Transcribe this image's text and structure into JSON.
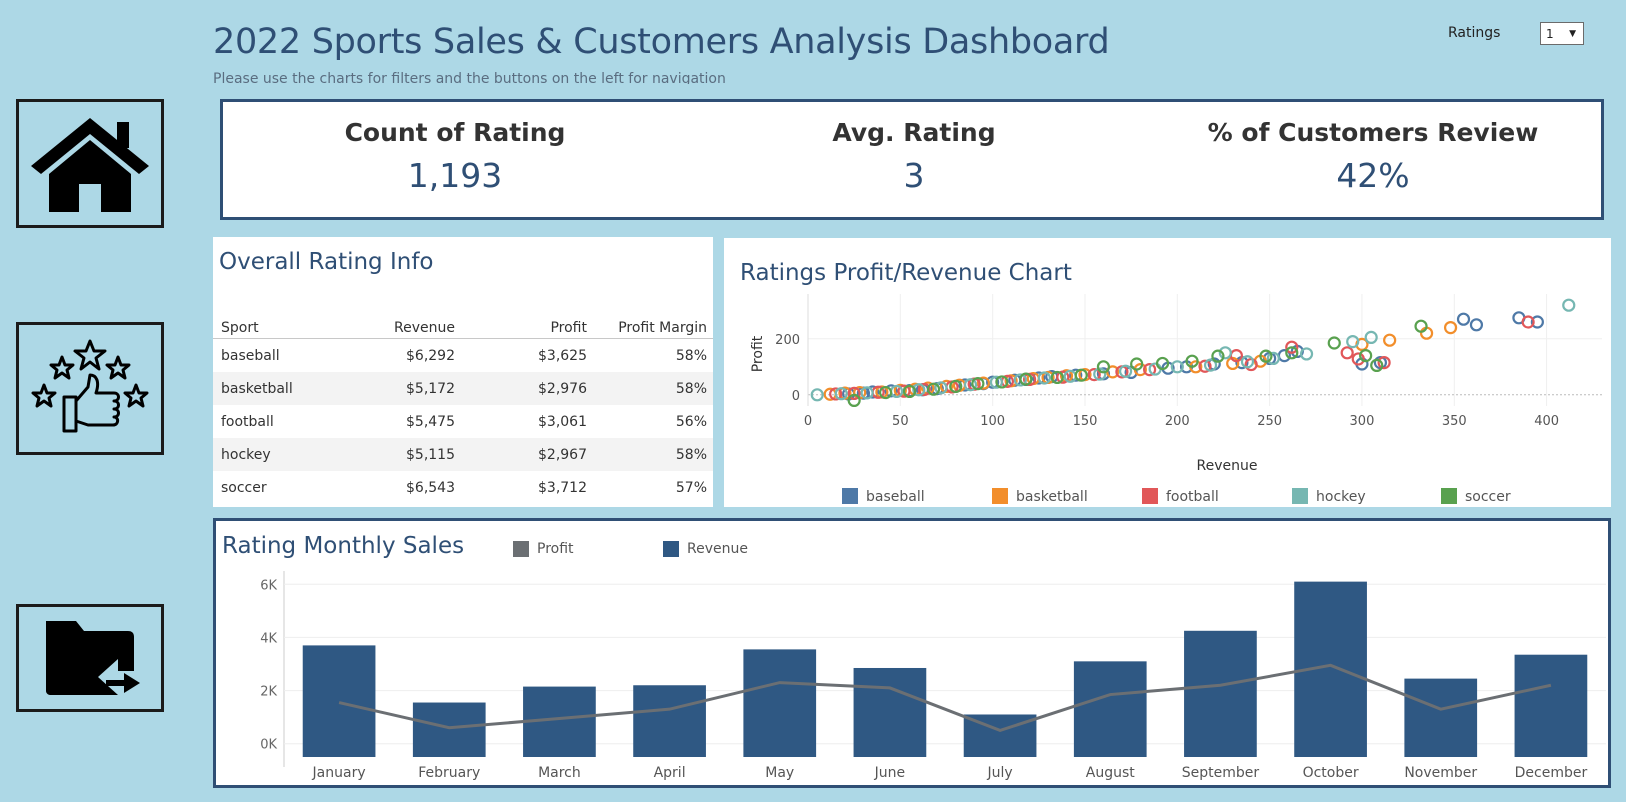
{
  "header": {
    "title": "2022 Sports Sales & Customers Analysis Dashboard",
    "subtitle": "Please use the charts for filters and the buttons on the left for navigation",
    "ratings_label": "Ratings",
    "ratings_value": "1"
  },
  "nav": [
    {
      "icon": "home-icon"
    },
    {
      "icon": "star-thumbs-up-icon"
    },
    {
      "icon": "folder-export-icon"
    }
  ],
  "kpis": {
    "count": {
      "title": "Count of Rating",
      "value": "1,193"
    },
    "avg": {
      "title": "Avg. Rating",
      "value": "3"
    },
    "pct": {
      "title": "% of Customers Review",
      "value": "42%"
    }
  },
  "rating_table": {
    "title": "Overall Rating Info",
    "headers": [
      "Sport",
      "Revenue",
      "Profit",
      "Profit Margin"
    ],
    "rows": [
      [
        "baseball",
        "$6,292",
        "$3,625",
        "58%"
      ],
      [
        "basketball",
        "$5,172",
        "$2,976",
        "58%"
      ],
      [
        "football",
        "$5,475",
        "$3,061",
        "56%"
      ],
      [
        "hockey",
        "$5,115",
        "$2,967",
        "58%"
      ],
      [
        "soccer",
        "$6,543",
        "$3,712",
        "57%"
      ]
    ]
  },
  "colors": {
    "baseball": "#4e79a7",
    "basketball": "#f28e2b",
    "football": "#e15759",
    "hockey": "#76b7b2",
    "soccer": "#59a14f",
    "revenue_bar": "#2f5883",
    "profit_line": "#6b6f73"
  },
  "chart_data": [
    {
      "type": "scatter",
      "title": "Ratings Profit/Revenue Chart",
      "xlabel": "Revenue",
      "ylabel": "Profit",
      "xlim": [
        0,
        430
      ],
      "ylim": [
        -40,
        360
      ],
      "x_ticks": [
        0,
        50,
        100,
        150,
        200,
        250,
        300,
        350,
        400
      ],
      "y_ticks": [
        0,
        200
      ],
      "legend_position": "bottom",
      "series": [
        {
          "name": "baseball",
          "points": [
            [
              22,
              3
            ],
            [
              30,
              6
            ],
            [
              35,
              10
            ],
            [
              45,
              14
            ],
            [
              55,
              15
            ],
            [
              62,
              18
            ],
            [
              70,
              22
            ],
            [
              85,
              35
            ],
            [
              95,
              40
            ],
            [
              100,
              45
            ],
            [
              112,
              52
            ],
            [
              118,
              55
            ],
            [
              125,
              60
            ],
            [
              132,
              65
            ],
            [
              145,
              70
            ],
            [
              160,
              75
            ],
            [
              175,
              80
            ],
            [
              195,
              95
            ],
            [
              205,
              100
            ],
            [
              220,
              110
            ],
            [
              235,
              115
            ],
            [
              250,
              130
            ],
            [
              258,
              140
            ],
            [
              265,
              155
            ],
            [
              300,
              110
            ],
            [
              310,
              115
            ],
            [
              355,
              270
            ],
            [
              362,
              250
            ],
            [
              385,
              275
            ],
            [
              395,
              260
            ]
          ]
        },
        {
          "name": "basketball",
          "points": [
            [
              12,
              2
            ],
            [
              20,
              6
            ],
            [
              28,
              8
            ],
            [
              40,
              10
            ],
            [
              50,
              16
            ],
            [
              58,
              20
            ],
            [
              65,
              24
            ],
            [
              75,
              30
            ],
            [
              82,
              34
            ],
            [
              95,
              42
            ],
            [
              110,
              50
            ],
            [
              122,
              58
            ],
            [
              130,
              62
            ],
            [
              140,
              68
            ],
            [
              150,
              72
            ],
            [
              165,
              82
            ],
            [
              180,
              90
            ],
            [
              210,
              100
            ],
            [
              230,
              112
            ],
            [
              245,
              120
            ],
            [
              300,
              180
            ],
            [
              315,
              195
            ],
            [
              335,
              220
            ],
            [
              348,
              240
            ]
          ]
        },
        {
          "name": "football",
          "points": [
            [
              15,
              3
            ],
            [
              25,
              5
            ],
            [
              38,
              9
            ],
            [
              52,
              13
            ],
            [
              63,
              19
            ],
            [
              78,
              28
            ],
            [
              90,
              38
            ],
            [
              108,
              48
            ],
            [
              120,
              55
            ],
            [
              138,
              63
            ],
            [
              155,
              72
            ],
            [
              170,
              82
            ],
            [
              185,
              90
            ],
            [
              215,
              102
            ],
            [
              232,
              140
            ],
            [
              240,
              108
            ],
            [
              262,
              170
            ],
            [
              292,
              150
            ],
            [
              298,
              128
            ],
            [
              312,
              115
            ],
            [
              390,
              260
            ]
          ]
        },
        {
          "name": "hockey",
          "points": [
            [
              5,
              0
            ],
            [
              18,
              4
            ],
            [
              32,
              7
            ],
            [
              48,
              12
            ],
            [
              60,
              18
            ],
            [
              72,
              25
            ],
            [
              88,
              36
            ],
            [
              102,
              45
            ],
            [
              115,
              53
            ],
            [
              128,
              60
            ],
            [
              142,
              66
            ],
            [
              158,
              74
            ],
            [
              172,
              84
            ],
            [
              188,
              92
            ],
            [
              200,
              100
            ],
            [
              218,
              106
            ],
            [
              226,
              150
            ],
            [
              238,
              118
            ],
            [
              252,
              130
            ],
            [
              270,
              146
            ],
            [
              295,
              190
            ],
            [
              305,
              205
            ],
            [
              412,
              320
            ]
          ]
        },
        {
          "name": "soccer",
          "points": [
            [
              25,
              -20
            ],
            [
              42,
              8
            ],
            [
              55,
              12
            ],
            [
              68,
              20
            ],
            [
              80,
              30
            ],
            [
              92,
              40
            ],
            [
              105,
              46
            ],
            [
              118,
              56
            ],
            [
              135,
              62
            ],
            [
              148,
              70
            ],
            [
              160,
              100
            ],
            [
              178,
              110
            ],
            [
              192,
              112
            ],
            [
              208,
              120
            ],
            [
              222,
              138
            ],
            [
              248,
              138
            ],
            [
              262,
              150
            ],
            [
              285,
              185
            ],
            [
              302,
              140
            ],
            [
              308,
              105
            ],
            [
              332,
              245
            ]
          ]
        }
      ]
    },
    {
      "type": "bar",
      "title": "Rating Monthly Sales",
      "categories": [
        "January",
        "February",
        "March",
        "April",
        "May",
        "June",
        "July",
        "August",
        "September",
        "October",
        "November",
        "December"
      ],
      "ylim": [
        -500,
        6500
      ],
      "y_ticks": [
        {
          "value": 0,
          "label": "0K"
        },
        {
          "value": 2000,
          "label": "2K"
        },
        {
          "value": 4000,
          "label": "4K"
        },
        {
          "value": 6000,
          "label": "6K"
        }
      ],
      "legend_position": "top",
      "series": [
        {
          "name": "Revenue",
          "kind": "bar",
          "values": [
            3700,
            1550,
            2150,
            2200,
            3550,
            2850,
            1100,
            3100,
            4250,
            6100,
            2450,
            3350
          ]
        },
        {
          "name": "Profit",
          "kind": "line",
          "values": [
            1550,
            600,
            950,
            1300,
            2300,
            2100,
            500,
            1850,
            2200,
            2950,
            1300,
            2200
          ]
        }
      ]
    }
  ]
}
